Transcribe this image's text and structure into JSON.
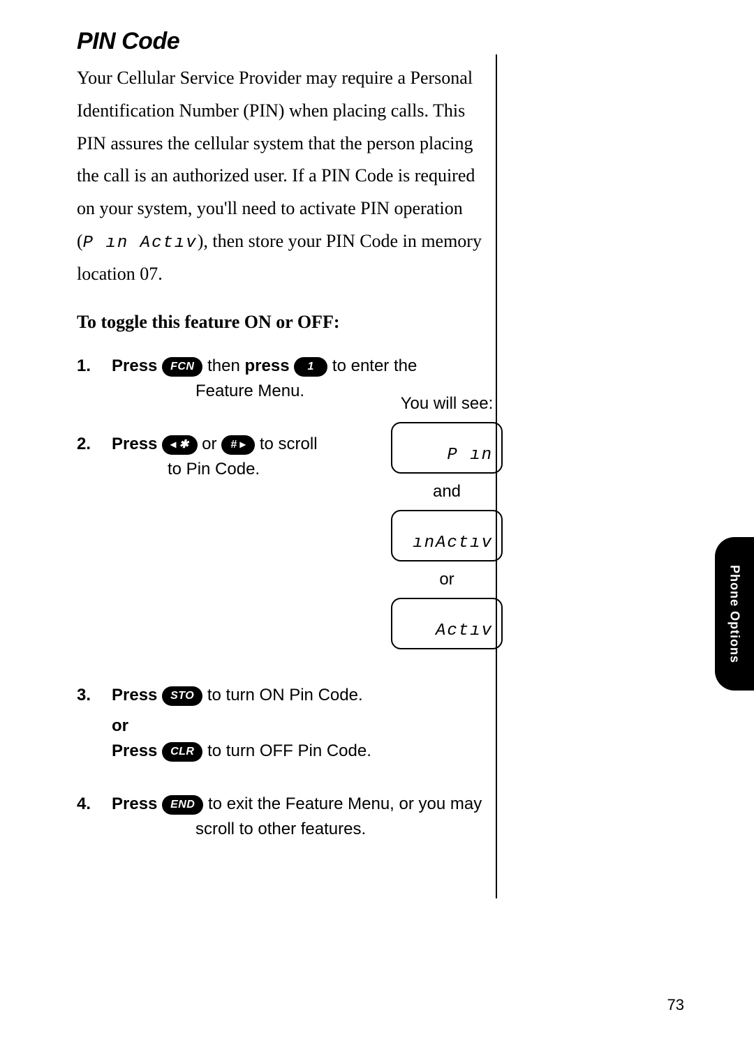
{
  "title": "PIN Code",
  "intro_pre": "Your Cellular Service Provider may require a Personal Identification Number (PIN) when placing calls. This PIN assures the cellular system that the person placing the call is an authorized user. If a PIN Code is required on your system, you'll need to activate PIN operation (",
  "intro_seg": "P ın  Actıv",
  "intro_post": "), then store your PIN Code in memory location 07.",
  "subhead": "To toggle this feature ON or OFF:",
  "step1": {
    "press": "Press",
    "key1": "FCN",
    "then": " then ",
    "press2": "press",
    "key2": "1",
    "tail": " to enter the",
    "line2": "Feature Menu."
  },
  "step2": {
    "press": "Press",
    "key_left": "✱",
    "or": " or ",
    "key_right": "#",
    "tail": " to scroll",
    "line2": "to Pin Code.",
    "you_will_see": "You will see:",
    "lcd1": "P ın",
    "and": "and",
    "lcd2": "ınActıv",
    "or2": "or",
    "lcd3": "Actıv"
  },
  "step3": {
    "press": "Press",
    "key_sto": "STO",
    "tail_on": " to turn ON Pin Code.",
    "or": "or",
    "press2": "Press",
    "key_clr": "CLR",
    "tail_off": " to turn OFF Pin Code."
  },
  "step4": {
    "press": "Press",
    "key_end": "END",
    "tail": " to exit the Feature Menu, or you may",
    "line2": "scroll to other features."
  },
  "sidebar": "Phone Options",
  "page_number": "73"
}
